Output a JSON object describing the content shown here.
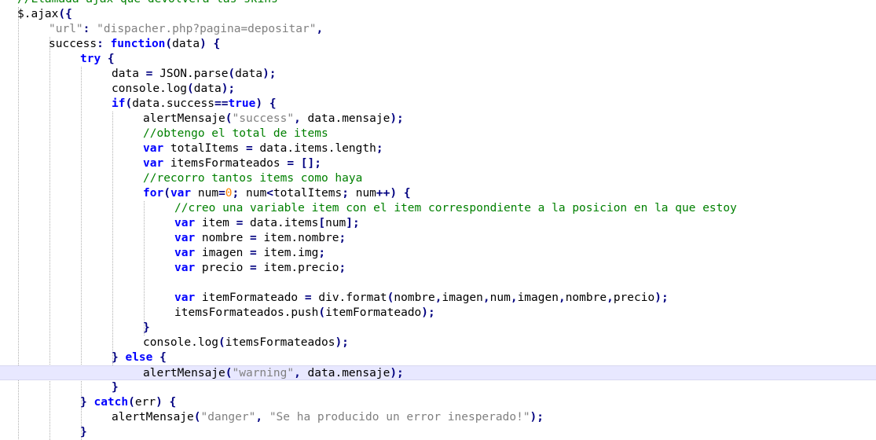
{
  "editor": {
    "colors": {
      "comment": "#008000",
      "keyword": "#0000ff",
      "string": "#808080",
      "number": "#ff8000",
      "operator": "#000080",
      "identifier": "#000000",
      "current_line_bg": "#e8e8ff"
    },
    "current_line_index": 25,
    "lines": [
      [
        {
          "t": "cmt",
          "v": "//Llamada ajax que devolvera las skins"
        }
      ],
      [
        {
          "t": "id",
          "v": "$.ajax"
        },
        {
          "t": "op",
          "v": "({"
        }
      ],
      [
        {
          "t": "str",
          "v": "\"url\""
        },
        {
          "t": "op",
          "v": ": "
        },
        {
          "t": "str",
          "v": "\"dispacher.php?pagina=depositar\""
        },
        {
          "t": "op",
          "v": ","
        }
      ],
      [
        {
          "t": "id",
          "v": "success"
        },
        {
          "t": "op",
          "v": ": "
        },
        {
          "t": "kw",
          "v": "function"
        },
        {
          "t": "op",
          "v": "("
        },
        {
          "t": "id",
          "v": "data"
        },
        {
          "t": "op",
          "v": ") {"
        }
      ],
      [
        {
          "t": "kw",
          "v": "try"
        },
        {
          "t": "op",
          "v": " {"
        }
      ],
      [
        {
          "t": "id",
          "v": "data "
        },
        {
          "t": "op",
          "v": "="
        },
        {
          "t": "id",
          "v": " JSON.parse"
        },
        {
          "t": "op",
          "v": "("
        },
        {
          "t": "id",
          "v": "data"
        },
        {
          "t": "op",
          "v": ");"
        }
      ],
      [
        {
          "t": "id",
          "v": "console.log"
        },
        {
          "t": "op",
          "v": "("
        },
        {
          "t": "id",
          "v": "data"
        },
        {
          "t": "op",
          "v": ");"
        }
      ],
      [
        {
          "t": "kw",
          "v": "if"
        },
        {
          "t": "op",
          "v": "("
        },
        {
          "t": "id",
          "v": "data.success"
        },
        {
          "t": "op",
          "v": "=="
        },
        {
          "t": "kw",
          "v": "true"
        },
        {
          "t": "op",
          "v": ") {"
        }
      ],
      [
        {
          "t": "id",
          "v": "alertMensaje"
        },
        {
          "t": "op",
          "v": "("
        },
        {
          "t": "str",
          "v": "\"success\""
        },
        {
          "t": "op",
          "v": ", "
        },
        {
          "t": "id",
          "v": "data.mensaje"
        },
        {
          "t": "op",
          "v": ");"
        }
      ],
      [
        {
          "t": "cmt",
          "v": "//obtengo el total de items"
        }
      ],
      [
        {
          "t": "kw",
          "v": "var"
        },
        {
          "t": "id",
          "v": " totalItems "
        },
        {
          "t": "op",
          "v": "="
        },
        {
          "t": "id",
          "v": " data.items.length"
        },
        {
          "t": "op",
          "v": ";"
        }
      ],
      [
        {
          "t": "kw",
          "v": "var"
        },
        {
          "t": "id",
          "v": " itemsFormateados "
        },
        {
          "t": "op",
          "v": "= [];"
        }
      ],
      [
        {
          "t": "cmt",
          "v": "//recorro tantos items como haya"
        }
      ],
      [
        {
          "t": "kw",
          "v": "for"
        },
        {
          "t": "op",
          "v": "("
        },
        {
          "t": "kw",
          "v": "var"
        },
        {
          "t": "id",
          "v": " num"
        },
        {
          "t": "op",
          "v": "="
        },
        {
          "t": "num",
          "v": "0"
        },
        {
          "t": "op",
          "v": "; "
        },
        {
          "t": "id",
          "v": "num"
        },
        {
          "t": "op",
          "v": "<"
        },
        {
          "t": "id",
          "v": "totalItems"
        },
        {
          "t": "op",
          "v": "; "
        },
        {
          "t": "id",
          "v": "num"
        },
        {
          "t": "op",
          "v": "++) {"
        }
      ],
      [
        {
          "t": "cmt",
          "v": "//creo una variable item con el item correspondiente a la posicion en la que estoy"
        }
      ],
      [
        {
          "t": "kw",
          "v": "var"
        },
        {
          "t": "id",
          "v": " item "
        },
        {
          "t": "op",
          "v": "="
        },
        {
          "t": "id",
          "v": " data.items"
        },
        {
          "t": "op",
          "v": "["
        },
        {
          "t": "id",
          "v": "num"
        },
        {
          "t": "op",
          "v": "];"
        }
      ],
      [
        {
          "t": "kw",
          "v": "var"
        },
        {
          "t": "id",
          "v": " nombre "
        },
        {
          "t": "op",
          "v": "="
        },
        {
          "t": "id",
          "v": " item.nombre"
        },
        {
          "t": "op",
          "v": ";"
        }
      ],
      [
        {
          "t": "kw",
          "v": "var"
        },
        {
          "t": "id",
          "v": " imagen "
        },
        {
          "t": "op",
          "v": "="
        },
        {
          "t": "id",
          "v": " item.img"
        },
        {
          "t": "op",
          "v": ";"
        }
      ],
      [
        {
          "t": "kw",
          "v": "var"
        },
        {
          "t": "id",
          "v": " precio "
        },
        {
          "t": "op",
          "v": "="
        },
        {
          "t": "id",
          "v": " item.precio"
        },
        {
          "t": "op",
          "v": ";"
        }
      ],
      [],
      [
        {
          "t": "kw",
          "v": "var"
        },
        {
          "t": "id",
          "v": " itemFormateado "
        },
        {
          "t": "op",
          "v": "="
        },
        {
          "t": "id",
          "v": " div.format"
        },
        {
          "t": "op",
          "v": "("
        },
        {
          "t": "id",
          "v": "nombre"
        },
        {
          "t": "op",
          "v": ","
        },
        {
          "t": "id",
          "v": "imagen"
        },
        {
          "t": "op",
          "v": ","
        },
        {
          "t": "id",
          "v": "num"
        },
        {
          "t": "op",
          "v": ","
        },
        {
          "t": "id",
          "v": "imagen"
        },
        {
          "t": "op",
          "v": ","
        },
        {
          "t": "id",
          "v": "nombre"
        },
        {
          "t": "op",
          "v": ","
        },
        {
          "t": "id",
          "v": "precio"
        },
        {
          "t": "op",
          "v": ");"
        }
      ],
      [
        {
          "t": "id",
          "v": "itemsFormateados.push"
        },
        {
          "t": "op",
          "v": "("
        },
        {
          "t": "id",
          "v": "itemFormateado"
        },
        {
          "t": "op",
          "v": ");"
        }
      ],
      [
        {
          "t": "op",
          "v": "}"
        }
      ],
      [
        {
          "t": "id",
          "v": "console.log"
        },
        {
          "t": "op",
          "v": "("
        },
        {
          "t": "id",
          "v": "itemsFormateados"
        },
        {
          "t": "op",
          "v": ");"
        }
      ],
      [
        {
          "t": "op",
          "v": "} "
        },
        {
          "t": "kw",
          "v": "else"
        },
        {
          "t": "op",
          "v": " {"
        }
      ],
      [
        {
          "t": "id",
          "v": "alertMensaje"
        },
        {
          "t": "op",
          "v": "("
        },
        {
          "t": "str",
          "v": "\"warning\""
        },
        {
          "t": "op",
          "v": ", "
        },
        {
          "t": "id",
          "v": "data.mensaje"
        },
        {
          "t": "op",
          "v": ");"
        }
      ],
      [
        {
          "t": "op",
          "v": "}"
        }
      ],
      [
        {
          "t": "op",
          "v": "} "
        },
        {
          "t": "kw",
          "v": "catch"
        },
        {
          "t": "op",
          "v": "("
        },
        {
          "t": "id",
          "v": "err"
        },
        {
          "t": "op",
          "v": ") {"
        }
      ],
      [
        {
          "t": "id",
          "v": "alertMensaje"
        },
        {
          "t": "op",
          "v": "("
        },
        {
          "t": "str",
          "v": "\"danger\""
        },
        {
          "t": "op",
          "v": ", "
        },
        {
          "t": "str",
          "v": "\"Se ha producido un error inesperado!\""
        },
        {
          "t": "op",
          "v": ");"
        }
      ],
      [
        {
          "t": "op",
          "v": "}"
        }
      ]
    ]
  }
}
